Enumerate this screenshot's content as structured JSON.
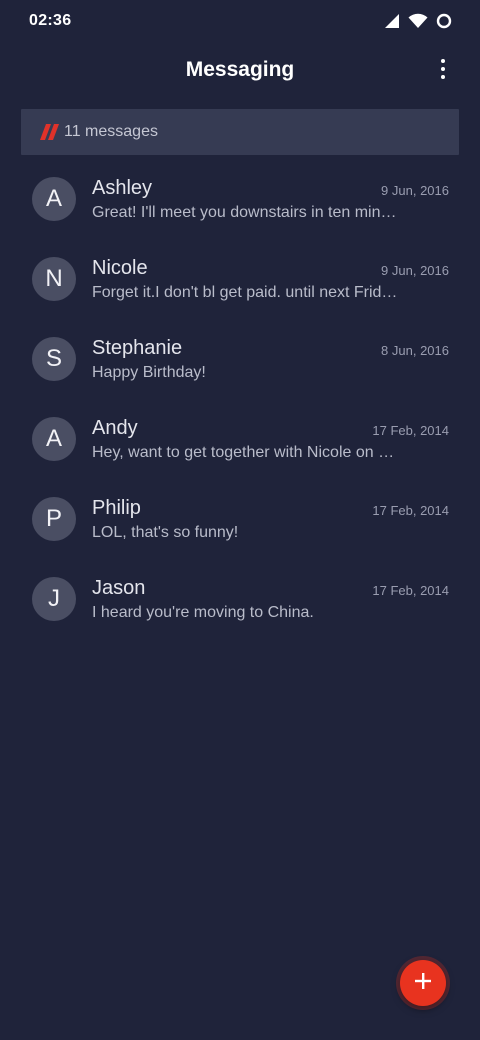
{
  "status_bar": {
    "time": "02:36",
    "icons": [
      "cell-signal-icon",
      "wifi-icon",
      "battery-ring-icon"
    ]
  },
  "header": {
    "title": "Messaging",
    "menu_icon": "more-vert-icon"
  },
  "banner": {
    "icon": "red-slash-logo-icon",
    "text": "11 messages"
  },
  "conversations": [
    {
      "initial": "A",
      "name": "Ashley",
      "date": "9 Jun, 2016",
      "preview": "Great! I'll meet you downstairs in ten min…"
    },
    {
      "initial": "N",
      "name": "Nicole",
      "date": "9 Jun, 2016",
      "preview": "Forget it.I don't bl get paid. until next Frid…"
    },
    {
      "initial": "S",
      "name": "Stephanie",
      "date": "8 Jun, 2016",
      "preview": "Happy Birthday!"
    },
    {
      "initial": "A",
      "name": "Andy",
      "date": "17 Feb, 2014",
      "preview": "Hey, want to get together with Nicole on F…"
    },
    {
      "initial": "P",
      "name": "Philip",
      "date": "17 Feb, 2014",
      "preview": "LOL, that's so funny!"
    },
    {
      "initial": "J",
      "name": "Jason",
      "date": "17 Feb, 2014",
      "preview": "I heard you're moving to China."
    }
  ],
  "fab": {
    "icon": "plus-icon"
  },
  "colors": {
    "background": "#1f233a",
    "banner": "#363b53",
    "avatar": "#4a4e63",
    "accent": "#e8331f"
  }
}
